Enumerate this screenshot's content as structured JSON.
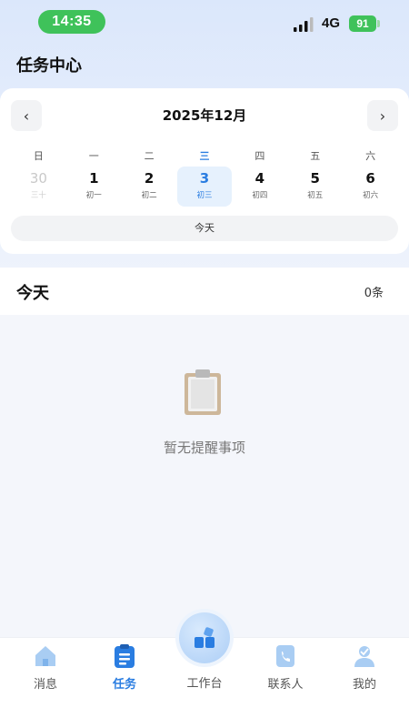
{
  "status_bar": {
    "time": "14:35",
    "network": "4G",
    "battery": "91"
  },
  "page": {
    "title": "任务中心"
  },
  "calendar": {
    "month_title": "2025年12月",
    "prev_icon": "‹",
    "next_icon": "›",
    "weekdays": [
      "日",
      "一",
      "二",
      "三",
      "四",
      "五",
      "六"
    ],
    "days": [
      {
        "num": "30",
        "lunar": "三十"
      },
      {
        "num": "1",
        "lunar": "初一"
      },
      {
        "num": "2",
        "lunar": "初二"
      },
      {
        "num": "3",
        "lunar": "初三"
      },
      {
        "num": "4",
        "lunar": "初四"
      },
      {
        "num": "5",
        "lunar": "初五"
      },
      {
        "num": "6",
        "lunar": "初六"
      }
    ],
    "selected_index": 3,
    "today_label": "今天"
  },
  "section": {
    "title": "今天",
    "count": "0条"
  },
  "empty": {
    "text": "暂无提醒事项"
  },
  "tabs": [
    {
      "label": "消息",
      "icon": "home-icon"
    },
    {
      "label": "任务",
      "icon": "task-clipboard-icon",
      "active": true
    },
    {
      "label": "工作台",
      "icon": "workbench-blocks-icon"
    },
    {
      "label": "联系人",
      "icon": "contacts-phone-icon"
    },
    {
      "label": "我的",
      "icon": "profile-icon"
    }
  ],
  "colors": {
    "accent": "#2a7de1",
    "status_green": "#3fc25a",
    "background": "#f4f6fb"
  }
}
